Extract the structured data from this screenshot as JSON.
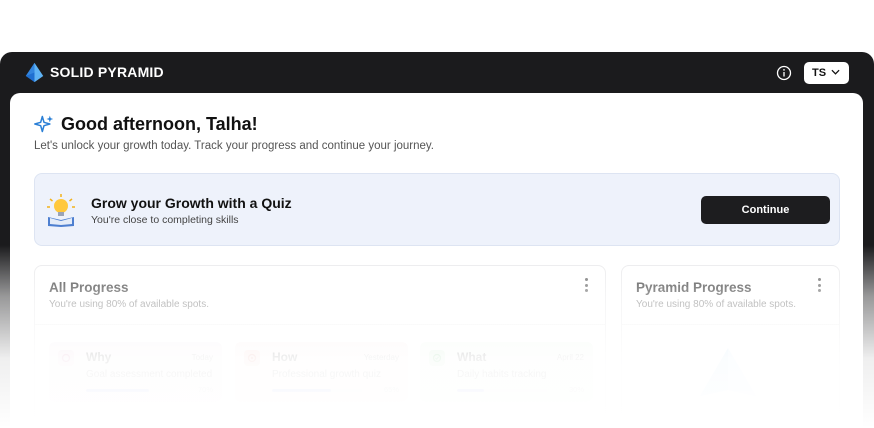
{
  "app": {
    "brand": "SOLID PYRAMID"
  },
  "header": {
    "user_initials": "TS"
  },
  "greeting": {
    "title": "Good afternoon, Talha!",
    "subtitle": "Let's unlock your growth today. Track your progress and continue your journey."
  },
  "quiz_banner": {
    "title": "Grow your Growth with a Quiz",
    "subtitle": "You're close to completing skills",
    "button_label": "Continue"
  },
  "all_progress": {
    "title": "All Progress",
    "subtitle": "You're using 80% of available spots.",
    "items": [
      {
        "name": "Why",
        "when": "Today",
        "desc": "Goal assessment completed",
        "progress_label": "70%",
        "progress": 0.7,
        "color": "#c86b9a"
      },
      {
        "name": "How",
        "when": "Yesterday",
        "desc": "Professional growth quiz",
        "progress_label": "65%",
        "progress": 0.65,
        "color": "#d9695f"
      },
      {
        "name": "What",
        "when": "April 22",
        "desc": "Daily habits tracking",
        "progress_label": "30%",
        "progress": 0.3,
        "color": "#3fae4f"
      }
    ]
  },
  "pyramid_progress": {
    "title": "Pyramid Progress",
    "subtitle": "You're using 80% of available spots."
  },
  "colors": {
    "brand_blue": "#2f7fd9",
    "dark": "#1b1b1d",
    "banner_bg": "#eef2fb"
  }
}
